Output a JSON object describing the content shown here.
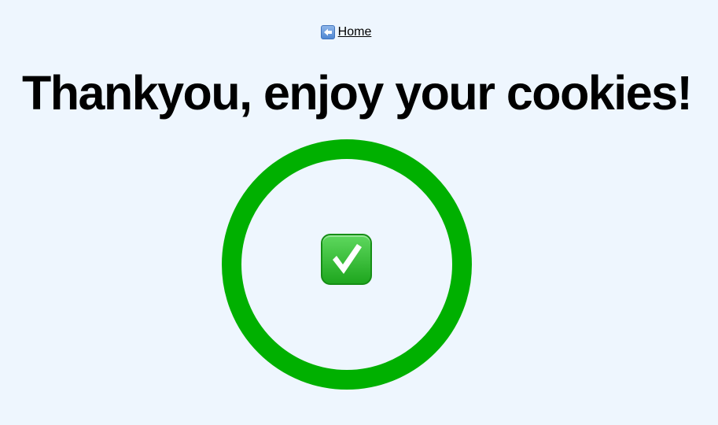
{
  "nav": {
    "home_label": "Home",
    "icon": "back-arrow-icon"
  },
  "main": {
    "title": "Thankyou, enjoy your cookies!",
    "success_icon": "check-mark-button-icon",
    "ring_color": "#00b000"
  }
}
